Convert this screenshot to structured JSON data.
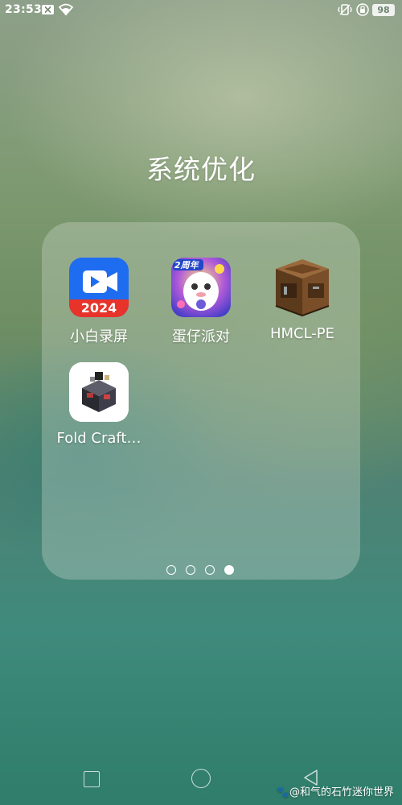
{
  "status_bar": {
    "time": "23:53",
    "battery": "98"
  },
  "folder": {
    "title": "系统优化",
    "apps": [
      {
        "label": "小白录屏",
        "icon": "screen-recorder-icon",
        "badge": "2024"
      },
      {
        "label": "蛋仔派对",
        "icon": "eggy-party-icon",
        "badge": "2周年"
      },
      {
        "label": "HMCL-PE",
        "icon": "crafting-table-icon"
      },
      {
        "label": "Fold Craft…",
        "icon": "fold-craft-icon"
      }
    ],
    "pages_total": 4,
    "current_page": 4
  },
  "watermark": "@和气的石竹迷你世界",
  "colors": {
    "recorder_blue": "#1e6df0",
    "recorder_red": "#e8332a"
  }
}
